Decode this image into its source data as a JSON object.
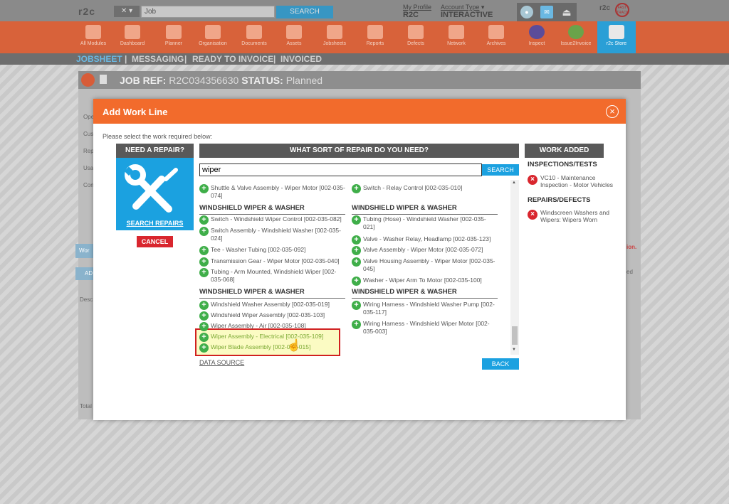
{
  "top": {
    "logo": "r2c",
    "job_search_value": "Job",
    "search_label": "SEARCH",
    "my_profile": "My Profile",
    "profile_name": "R2C",
    "account_type_label": "Account Type",
    "account_type": "INTERACTIVE"
  },
  "modules": [
    {
      "label": "All Modules",
      "icon": "grid-icon"
    },
    {
      "label": "Dashboard",
      "icon": "gauge-icon"
    },
    {
      "label": "Planner",
      "icon": "calendar-icon"
    },
    {
      "label": "Organisation",
      "icon": "building-icon"
    },
    {
      "label": "Documents",
      "icon": "folder-icon"
    },
    {
      "label": "Assets",
      "icon": "truck-icon"
    },
    {
      "label": "Jobsheets",
      "icon": "tools-icon"
    },
    {
      "label": "Reports",
      "icon": "clipboard-icon"
    },
    {
      "label": "Defects",
      "icon": "warning-icon"
    },
    {
      "label": "Network",
      "icon": "contact-icon"
    },
    {
      "label": "Archives",
      "icon": "archive-icon"
    },
    {
      "label": "Inspect",
      "icon": "inspect-icon"
    },
    {
      "label": "Issue2Invoice",
      "icon": "i2i-icon"
    },
    {
      "label": "r2c Store",
      "icon": "store-icon"
    }
  ],
  "nav": {
    "jobsheet": "JOBSHEET",
    "messaging": "MESSAGING",
    "ready": "READY TO INVOICE",
    "invoiced": "INVOICED",
    "sep": "|"
  },
  "job": {
    "ref_label": "JOB REF:",
    "ref": "R2C034356630",
    "status_label": "STATUS:",
    "status": "Planned"
  },
  "modal": {
    "title": "Add Work Line",
    "instruction": "Please select the work required below:",
    "need_repair": "NEED A REPAIR?",
    "search_repairs": "SEARCH REPAIRS",
    "cancel": "CANCEL",
    "what_sort": "WHAT SORT OF REPAIR DO YOU NEED?",
    "search_value": "wiper",
    "search_btn": "SEARCH",
    "data_source": "DATA SOURCE",
    "back": "BACK",
    "work_added": "WORK ADDED",
    "inspections_hdr": "INSPECTIONS/TESTS",
    "inspection_item": "VC10 - Maintenance Inspection - Motor Vehicles",
    "repairs_hdr": "REPAIRS/DEFECTS",
    "repair_item": "Windscreen Washers and Wipers: Wipers Worn"
  },
  "list": {
    "top_left": "Shuttle & Valve Assembly - Wiper Motor [002-035-074]",
    "top_right": "Switch - Relay Control [002-035-010]",
    "sec1_title": "WINDSHIELD WIPER & WASHER",
    "sec1_left": [
      "Switch - Windshield Wiper Control [002-035-082]",
      "Switch Assembly - Windshield Washer [002-035-024]",
      "Tee - Washer Tubing [002-035-092]",
      "Transmission Gear - Wiper Motor [002-035-040]",
      "Tubing - Arm Mounted, Windshield Wiper [002-035-068]"
    ],
    "sec1_right": [
      "Tubing (Hose) - Windshield Washer [002-035-021]",
      "Valve - Washer Relay, Headlamp [002-035-123]",
      "Valve Assembly - Wiper Motor [002-035-072]",
      "Valve Housing Assembly - Wiper Motor [002-035-045]",
      "Washer - Wiper Arm To Motor [002-035-100]"
    ],
    "sec2_title": "WINDSHIELD WIPER & WASHER",
    "sec2_left": [
      "Windshield Washer Assembly [002-035-019]",
      "Windshield Wiper Assembly [002-035-103]",
      "Wiper Assembly - Air [002-035-108]",
      "Wiper Assembly - Electrical [002-035-109]",
      "Wiper Blade Assembly [002-035-015]"
    ],
    "sec2_right": [
      "Wiring Harness - Windshield Washer Pump [002-035-117]",
      "Wiring Harness - Windshield Wiper Motor [002-035-003]"
    ]
  },
  "background": {
    "left_labels": [
      "Ope",
      "Cus",
      "Rep",
      "Usa",
      "Con"
    ],
    "work_btn": "Wor",
    "add_btn": "AD",
    "desc": "Desc",
    "total": "Total",
    "red_suffix": "ion.",
    "right_suffix": "ed"
  },
  "colors": {
    "orange": "#f26b2c",
    "blue": "#1ba1e0",
    "green": "#3fae49",
    "red": "#d9262e",
    "header_grey": "#595959"
  }
}
